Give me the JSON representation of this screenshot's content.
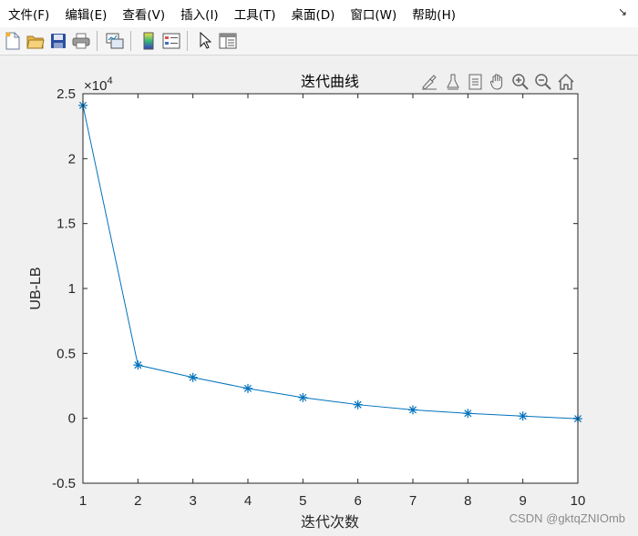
{
  "menu": {
    "items": [
      "文件(F)",
      "编辑(E)",
      "查看(V)",
      "插入(I)",
      "工具(T)",
      "桌面(D)",
      "窗口(W)",
      "帮助(H)"
    ],
    "collapse_icon": "arrow-se-icon"
  },
  "toolbar": {
    "icons": [
      "new-figure-icon",
      "open-file-icon",
      "save-icon",
      "print-icon",
      "link-plot-icon",
      "colorbar-icon",
      "legend-icon",
      "edit-plot-pointer-icon",
      "property-inspector-icon"
    ]
  },
  "axes_toolbar": {
    "icons": [
      "brush-icon",
      "data-tips-icon",
      "export-icon",
      "pan-hand-icon",
      "zoom-in-icon",
      "zoom-out-icon",
      "home-icon"
    ]
  },
  "chart_data": {
    "type": "line",
    "title": "迭代曲线",
    "xlabel": "迭代次数",
    "ylabel": "UB-LB",
    "exponent_label": "×10",
    "exponent_power": "4",
    "x": [
      1,
      2,
      3,
      4,
      5,
      6,
      7,
      8,
      9,
      10
    ],
    "series": [
      {
        "values": [
          24100,
          4100,
          3150,
          2300,
          1600,
          1050,
          650,
          380,
          170,
          -30
        ],
        "marker": "*",
        "color": "#0072bd"
      }
    ],
    "xlim": [
      1,
      10
    ],
    "ylim": [
      -5000,
      25000
    ],
    "xticks": [
      "1",
      "2",
      "3",
      "4",
      "5",
      "6",
      "7",
      "8",
      "9",
      "10"
    ],
    "yticks": [
      "-0.5",
      "0",
      "0.5",
      "1",
      "1.5",
      "2",
      "2.5"
    ],
    "ytick_values": [
      -5000,
      0,
      5000,
      10000,
      15000,
      20000,
      25000
    ],
    "grid": false
  },
  "watermark": "CSDN @gktqZNIOmb"
}
